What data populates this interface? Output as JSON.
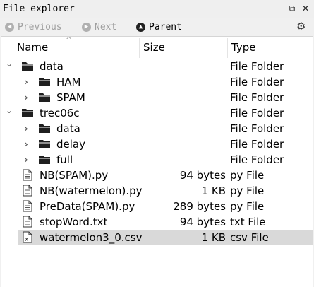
{
  "window": {
    "title": "File explorer",
    "undock_icon": "undock-icon",
    "close_icon": "close-icon"
  },
  "toolbar": {
    "previous_label": "Previous",
    "next_label": "Next",
    "parent_label": "Parent",
    "options_icon": "gear-icon"
  },
  "columns": {
    "name": "Name",
    "size": "Size",
    "type": "Type",
    "sort_indicator": "^"
  },
  "rows": [
    {
      "name": "data",
      "size": "",
      "type": "File Folder",
      "kind": "folder",
      "level": 0,
      "expanded": true
    },
    {
      "name": "HAM",
      "size": "",
      "type": "File Folder",
      "kind": "folder",
      "level": 1,
      "expanded": false
    },
    {
      "name": "SPAM",
      "size": "",
      "type": "File Folder",
      "kind": "folder",
      "level": 1,
      "expanded": false
    },
    {
      "name": "trec06c",
      "size": "",
      "type": "File Folder",
      "kind": "folder",
      "level": 0,
      "expanded": true
    },
    {
      "name": "data",
      "size": "",
      "type": "File Folder",
      "kind": "folder",
      "level": 1,
      "expanded": false
    },
    {
      "name": "delay",
      "size": "",
      "type": "File Folder",
      "kind": "folder",
      "level": 1,
      "expanded": false
    },
    {
      "name": "full",
      "size": "",
      "type": "File Folder",
      "kind": "folder",
      "level": 1,
      "expanded": false
    },
    {
      "name": "NB(SPAM).py",
      "size": "94 bytes",
      "type": "py File",
      "kind": "file"
    },
    {
      "name": "NB(watermelon).py",
      "size": "1 KB",
      "type": "py File",
      "kind": "file"
    },
    {
      "name": "PreData(SPAM).py",
      "size": "289 bytes",
      "type": "py File",
      "kind": "file"
    },
    {
      "name": "stopWord.txt",
      "size": "94 bytes",
      "type": "txt File",
      "kind": "file"
    },
    {
      "name": "watermelon3_0.csv",
      "size": "1 KB",
      "type": "csv File",
      "kind": "csv",
      "selected": true
    }
  ],
  "colors": {
    "selection": "#d9d9d9",
    "panel": "#ffffff",
    "chrome": "#f0f0f0"
  }
}
